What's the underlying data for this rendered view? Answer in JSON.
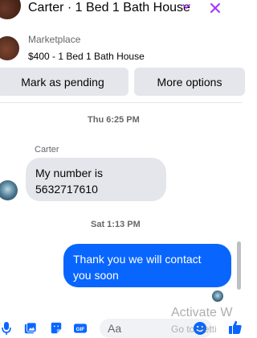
{
  "header": {
    "title": "Carter · 1 Bed 1 Bath House",
    "icons": {
      "dropdown": "chevron-down-icon",
      "close": "close-icon"
    }
  },
  "listing": {
    "label": "Marketplace",
    "text": "$400 - 1 Bed 1 Bath House"
  },
  "actions": {
    "pending_label": "Mark as pending",
    "more_label": "More options"
  },
  "conversation": {
    "timestamp_1": "Thu 6:25 PM",
    "sender": "Carter",
    "incoming": "My number is 5632717610",
    "timestamp_2": "Sat 1:13 PM",
    "outgoing": "Thank you we will contact you soon"
  },
  "composer": {
    "placeholder": "Aa",
    "icons": [
      "mic-icon",
      "photo-icon",
      "sticker-icon",
      "gif-icon",
      "emoji-icon",
      "like-icon"
    ]
  },
  "watermark": {
    "line1": "Activate W",
    "line2": "Go to Setti"
  },
  "colors": {
    "accent": "#0866ff",
    "bubble_gray": "#e4e6eb",
    "secondary_text": "#65676b",
    "close_icon": "#a033ff"
  }
}
